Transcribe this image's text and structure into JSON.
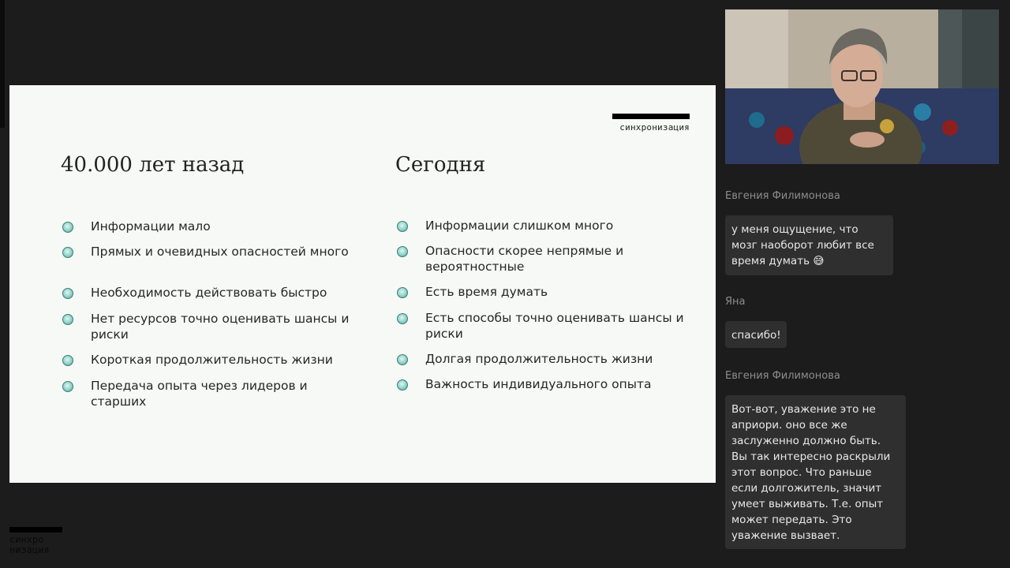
{
  "slide": {
    "brand": "синхронизация",
    "left_title": "40.000 лет назад",
    "right_title": "Сегодня",
    "left_items": [
      "Информации мало",
      "Прямых и очевидных опасностей много",
      "Необходимость действовать быстро",
      "Нет ресурсов точно оценивать шансы и риски",
      "Короткая продолжительность жизни",
      "Передача опыта через лидеров и старших"
    ],
    "right_items": [
      "Информации слишком много",
      "Опасности скорее непрямые и вероятностные",
      "Есть время думать",
      "Есть способы точно оценивать шансы и риски",
      "Долгая продолжительность жизни",
      "Важность индивидуального опыта"
    ]
  },
  "chat": [
    {
      "author": "Евгения Филимонова",
      "text": "у меня ощущение, что мозг наоборот любит все время думать 😅"
    },
    {
      "author": "Яна",
      "text": "спасибо!"
    },
    {
      "author": "Евгения Филимонова",
      "text": "Вот-вот, уважение это не априори. оно все же заслуженно должно быть. Вы так интересно раскрыли этот вопрос. Что раньше если долгожитель, значит умеет выживать. Т.е. опыт может передать. Это уважение вызвает."
    }
  ],
  "logo": {
    "line1": "синхро",
    "line2": "низация"
  },
  "colors": {
    "background": "#1c1c1c",
    "slide": "#f7f9f6",
    "bullet": "#9ed9d1",
    "chat_bubble": "#2f2f2f"
  }
}
